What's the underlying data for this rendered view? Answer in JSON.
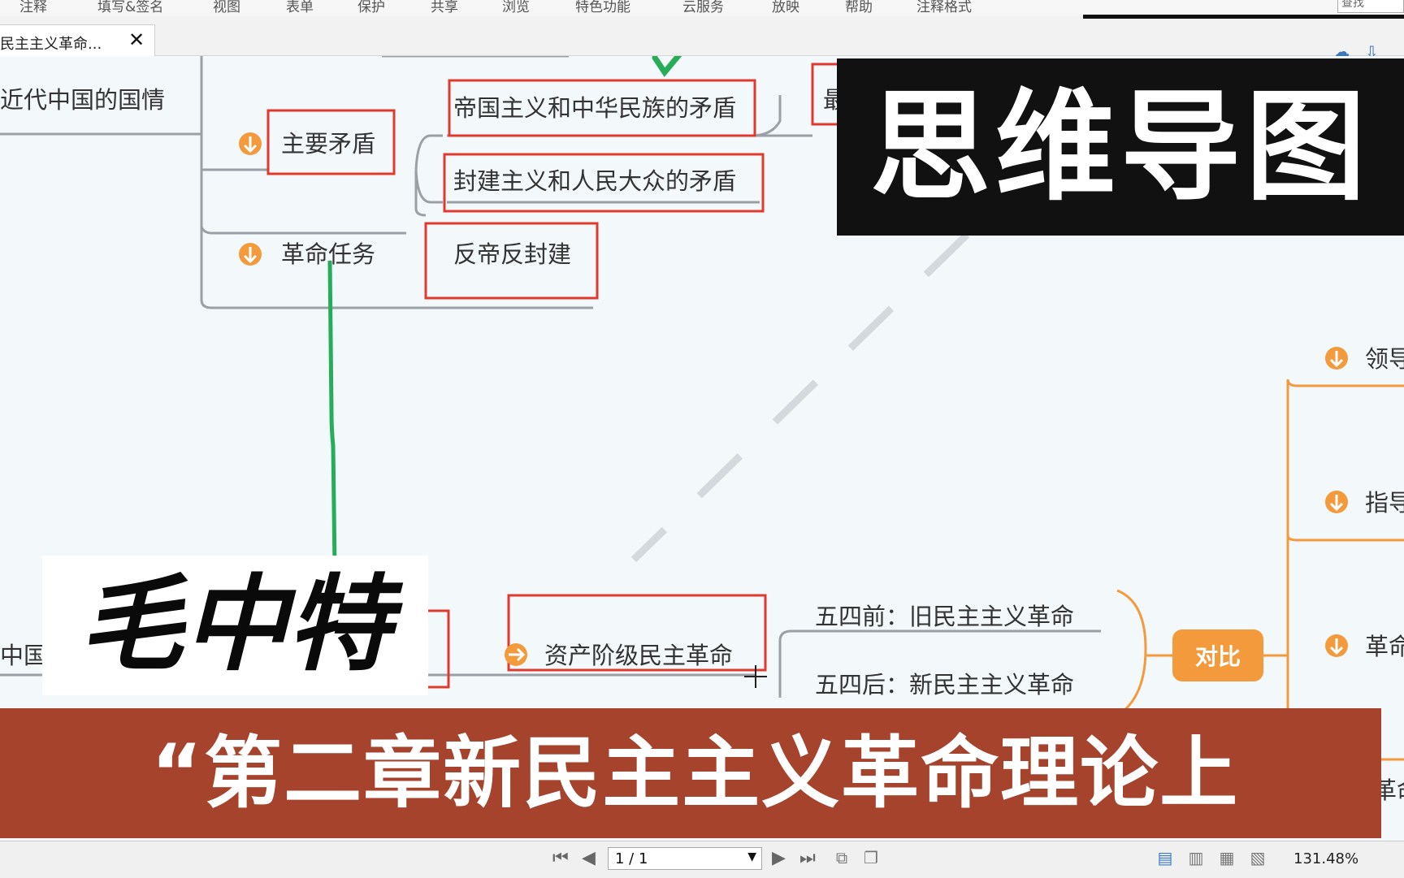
{
  "menubar": {
    "items": [
      "注释",
      "填写&签名",
      "视图",
      "表单",
      "保护",
      "共享",
      "浏览",
      "特色功能",
      "云服务",
      "放映",
      "帮助",
      "注释格式"
    ]
  },
  "search": {
    "placeholder": "查找"
  },
  "tab": {
    "title": "民主主义革命...",
    "close": "✕"
  },
  "mindmap": {
    "nodes": {
      "guoqing": "近代中国的国情",
      "zhuyao": "主要矛盾",
      "maodun1": "帝国主义和中华民族的矛盾",
      "maodun2": "封建主义和人民大众的矛盾",
      "renwu": "革命任务",
      "fandi": "反帝反封建",
      "zichan": "资产阶级民主革命",
      "jiu": "五四前：旧民主主义革命",
      "xin": "五四后：新民主主义革命",
      "duibi": "对比",
      "lingdao": "领导",
      "zhidao": "指导",
      "geming": "革命",
      "geming2": "革命",
      "zhongguo": "中国",
      "zui": "最"
    },
    "colors": {
      "accent": "#f39a3d",
      "highlight": "#e03a2f",
      "check": "#27ad5a",
      "line": "#9aa0a6"
    }
  },
  "overlays": {
    "stamp": "思维导图",
    "course": "毛中特",
    "chapter": "“第二章新民主主义革命理论上"
  },
  "statusbar": {
    "page": "1 / 1",
    "zoom": "131.48%"
  },
  "icons": {
    "first": "⏮",
    "prev": "◀",
    "next": "▶",
    "last": "⏭",
    "cloud": "☁",
    "download": "⇩"
  }
}
